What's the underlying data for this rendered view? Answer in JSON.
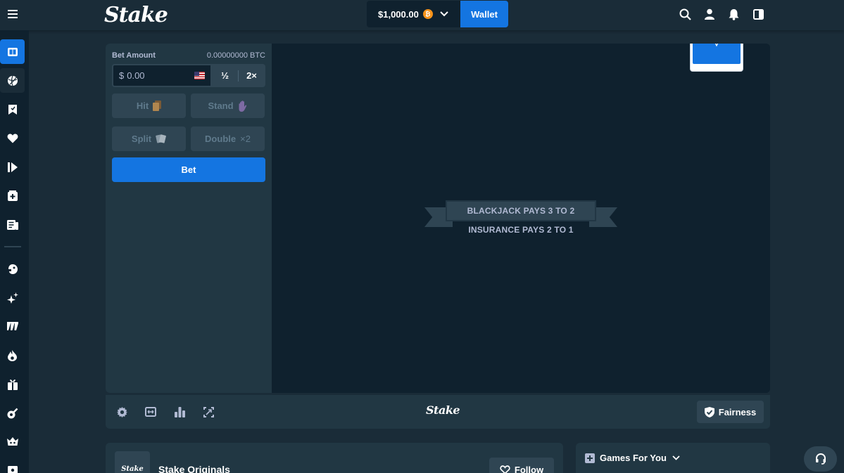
{
  "app": {
    "logo_text": "Stake"
  },
  "header": {
    "balance": "$1,000.00",
    "currency_icon": "bitcoin-icon",
    "currency_symbol": "₿",
    "wallet_label": "Wallet",
    "icons": [
      "search-icon",
      "user-icon",
      "notification-icon",
      "sidebar-toggle-icon"
    ]
  },
  "sidebar": {
    "items": [
      {
        "name": "casino",
        "icon": "casino-icon"
      },
      {
        "name": "sports",
        "icon": "sports-icon"
      },
      {
        "name": "bookmarks",
        "icon": "bookmark-icon"
      },
      {
        "name": "favourites",
        "icon": "heart-icon"
      },
      {
        "name": "recent",
        "icon": "recent-play-icon"
      },
      {
        "name": "challenges",
        "icon": "challenges-icon"
      },
      {
        "name": "my-bets",
        "icon": "bets-icon"
      },
      {
        "name": "originals",
        "icon": "originals-icon"
      },
      {
        "name": "new-releases",
        "icon": "sparkle-icon"
      },
      {
        "name": "slots",
        "icon": "slots-icon"
      },
      {
        "name": "hot",
        "icon": "fire-icon"
      },
      {
        "name": "promotions",
        "icon": "gift-icon"
      },
      {
        "name": "live-casino",
        "icon": "roulette-icon"
      },
      {
        "name": "game-shows",
        "icon": "crown-icon"
      },
      {
        "name": "more",
        "icon": "card-icon"
      }
    ]
  },
  "bet_panel": {
    "bet_amount_label": "Bet Amount",
    "btc_amount": "0.00000000 BTC",
    "currency_prefix": "$",
    "input_value": "0.00",
    "half_label": "½",
    "double_label": "2×",
    "hit_label": "Hit",
    "stand_label": "Stand",
    "split_label": "Split",
    "double_action_label": "Double",
    "double_multiplier": "×2",
    "bet_label": "Bet"
  },
  "table": {
    "blackjack_rule": "BLACKJACK PAYS 3 TO 2",
    "insurance_rule": "INSURANCE PAYS 2 TO 1"
  },
  "game_footer": {
    "logo_text": "Stake",
    "fairness_label": "Fairness",
    "icons": [
      "settings-icon",
      "theatre-mode-icon",
      "stats-icon",
      "fullscreen-icon"
    ]
  },
  "originals": {
    "thumb_text": "Stake",
    "title": "Stake Originals",
    "follow_label": "Follow"
  },
  "games_for_you": {
    "label": "Games For You"
  },
  "colors": {
    "bg": "#1a2c38",
    "panel": "#213743",
    "dark": "#0f212e",
    "button": "#2f4553",
    "accent": "#1475e1",
    "muted_text": "#b1bad3"
  }
}
